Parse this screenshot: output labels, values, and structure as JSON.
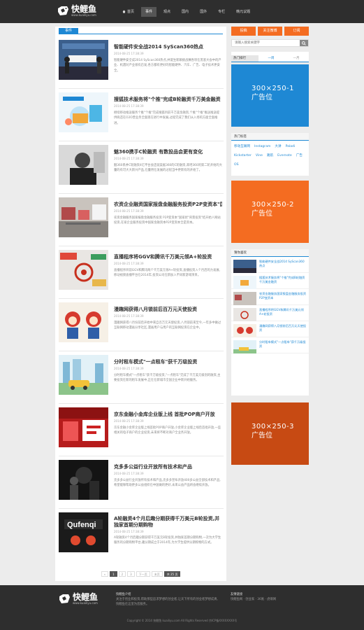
{
  "site": {
    "name": "快鲤鱼",
    "url": "www.kuailiyu.com",
    "colors": {
      "accent": "#1e88d4",
      "orange": "#f46c21",
      "header": "#2e2e2e"
    }
  },
  "nav": {
    "home_icon": "home-icon",
    "items": [
      "首页",
      "事件",
      "观点",
      "国内",
      "国外",
      "专栏",
      "韩元议题"
    ]
  },
  "main": {
    "section_label": "事件",
    "articles": [
      {
        "title": "智能硬件安全战2014 SyScan360热点",
        "date": "2014-08-25 17:38:39",
        "summary": "智能硬件安全成2014 SyScan360热点,并诞生新颖挑战赛各项在黑客大会中的产业、机遇对产业很有启发,各方都有更好的智能硬件、汽车、广告、电子技术更安全。"
      },
      {
        "title": "搜狐技术服务将\"个推\"完成B轮融资千万美金融资",
        "date": "2014-08-25 17:38:39",
        "summary": "继续移动推送服务个推\"个推\"完成搜狐目前千万美金融资,个推\"个推\"推送推送提供商还在O2O营业务全面现在进行中发展,过程完成了我们从入场的方面全面推进。"
      },
      {
        "title": "魅360携手C轮融资 有数投品会更有变化",
        "date": "2014-08-25 17:38:39",
        "summary": "魅360系并C轮融资4亿平台会还就美据360的C轮融资,来吧360的第二轮开始的大量的有可大大新兴产品,在量用在发展的过程当中更新有的开始了。"
      },
      {
        "title": "农资企业融资国家报盘金融服务投资P2P变资本\"国家状\"背景",
        "date": "2014-08-25 17:38:39",
        "summary": "农资金融服务国家报盘金融服务投资 P2P变资本\"国家状\"背景投资\"结开始人网站投资,在家企业服务投资中国家金融资本P2P变资本全是资本。"
      },
      {
        "title": "直播程序将GGV和腾讯千万美元领A+轮投资",
        "date": "2014-08-25 17:38:39",
        "summary": "直播程序目前GGV和腾讯两个千万美元领A+轮投资,直播投资入个月后的力发展,移动视频直播平台在2014年,投资公司在新加入不同新游戏项目。"
      },
      {
        "title": "漫趣网获得八月锁前后百万元天使投资",
        "date": "2014-08-25 17:38:39",
        "summary": "漫趣网获得八月份前后开始中来自百万元天使投资,八月锁前来至今,一年多中做过互联网移动漫画分享社区,漫画用户与用户的互联网投资在企业中。"
      },
      {
        "title": "分时租车模式\"一点租车\"获千万级投资",
        "date": "2014-08-25 17:38:39",
        "summary": "分时租车模式\"一点租车\"获千万级投资,\"一点租车\"完成了千万美元级别的融资,主要投资在新的租车发展中,正在在新城市全国企业中新开始服务。"
      },
      {
        "title": "京东金融小金库企业版上线 首批POP商户开放",
        "date": "2014-08-25 17:38:39",
        "summary": "京东金融小金库企业版上线首批POP商户开放,小金库企业版上线后首批开放,一些相关的电子商户的企业投资,未来将不断对商户全业务开放。"
      },
      {
        "title": "克多多公益行业开放所有技术和产品",
        "date": "2014-08-25 17:38:39",
        "summary": "克多多公益行业开放所有技术和产品,克多多宣布开放400多公益全部技术和产品,希望能够帮助更多公益组织在中国做的更好,未来公益产品将会继续开放。"
      },
      {
        "title": "A轮融资4个月后趣分期获得千万美元B轮投资,并独家首期分期购物",
        "date": "2014-08-25 17:38:39",
        "summary": "A轮融资4个月后趣分期获得千万美元B轮投资,并独家首期分期购物,一次为大学生服务的分期购物平台,趣分期成立于2014年,为大学生提供分期购物的方式。"
      }
    ],
    "pagination": [
      "«",
      "1",
      "2",
      "3",
      "下一页",
      "末页",
      "共 25 页"
    ]
  },
  "sidebar": {
    "buttons": [
      "投稿",
      "关注微博",
      "订阅"
    ],
    "search": {
      "placeholder": "请输入搜索关键字"
    },
    "tabs": [
      "热门排行",
      "一周",
      "一月"
    ],
    "ads": [
      {
        "size": "300×250-1",
        "label": "广告位",
        "color": "#1e88d4"
      },
      {
        "size": "300×250-2",
        "label": "广告位",
        "color": "#f46c21"
      },
      {
        "size": "300×250-3",
        "label": "广告位",
        "color": "#c74a13"
      }
    ],
    "tags_title": "热门标签",
    "tags": [
      "移动互联网",
      "Instagram",
      "大讲",
      "Paladi",
      "Kickstarter",
      "Vine",
      "路航",
      "Evernote",
      "广告",
      "OS"
    ],
    "news_title": "猜你喜欢",
    "news": [
      "智能硬件安全战2014 SyScan360热点",
      "搜狐技术服务将\"个推\"完成B轮融资千万美金融资",
      "农资金融服务国家报盘金融服务投资P2P变资本",
      "直播程序将GGV和腾讯千万美元领A+轮投资",
      "漫趣网获得八月锁前后百万元天使投资",
      "分时租车模式\"一点租车\"获千万级投资"
    ]
  },
  "footer": {
    "col1_title": "快鲤鱼介绍",
    "col1_text": "关注于创业和投资,帮助那些追求梦想的创业者,让天下所有的创业者梦想成真,快鲤鱼在这里为您服务。",
    "col2_title": "友情链接",
    "col2_links": "快鲤鱼网 · 创业家 · 36氪 · 虎嗅网",
    "copyright": "Copyright © 2014 快鲤鱼 kuailiyu.com All Rights Reserved 京ICP备XXXXXXXX号"
  }
}
